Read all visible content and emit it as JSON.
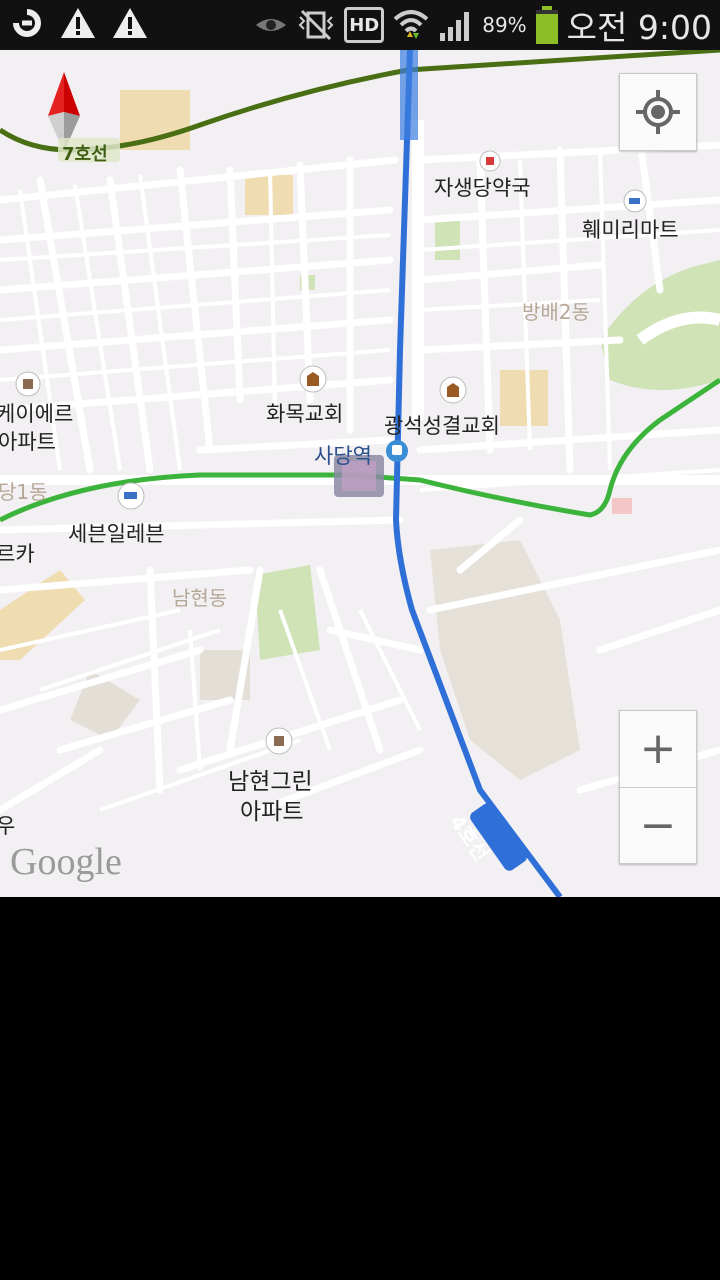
{
  "status_bar": {
    "battery": "89%",
    "time": "오전 9:00",
    "hd_label": "HD",
    "icons": [
      "app-notification-icon",
      "warning-icon",
      "warning-icon",
      "eye-icon",
      "vibrate-icon",
      "hd-voice-icon",
      "wifi-icon",
      "signal-icon",
      "battery-icon"
    ]
  },
  "map": {
    "lines": {
      "line7": "7호선",
      "line4": "4호선"
    },
    "places": {
      "pharmacy": "자생당약국",
      "mart": "훼미리마트",
      "area_bangbae2": "방배2동",
      "church_hwamok": "화목교회",
      "church_gwangseok": "광석성결교회",
      "apt_a_line1": "케이에르",
      "apt_a_line2": "아파트",
      "area_dong1": "당1동",
      "station": "사당역",
      "store_711": "세븐일레븐",
      "partial_ka": "르카",
      "area_namhyeon": "남현동",
      "apt_namhyeon_line1": "남현그린",
      "apt_namhyeon_line2": "아파트",
      "partial_u": "우"
    },
    "attribution": "Google",
    "colors": {
      "line2": "#3cb43c",
      "line4": "#2f6fd8",
      "line7": "#4a6e14",
      "park": "#cfe3b6",
      "building": "#efdcb0"
    }
  },
  "controls": {
    "zoom_in": "+",
    "zoom_out": "−"
  }
}
